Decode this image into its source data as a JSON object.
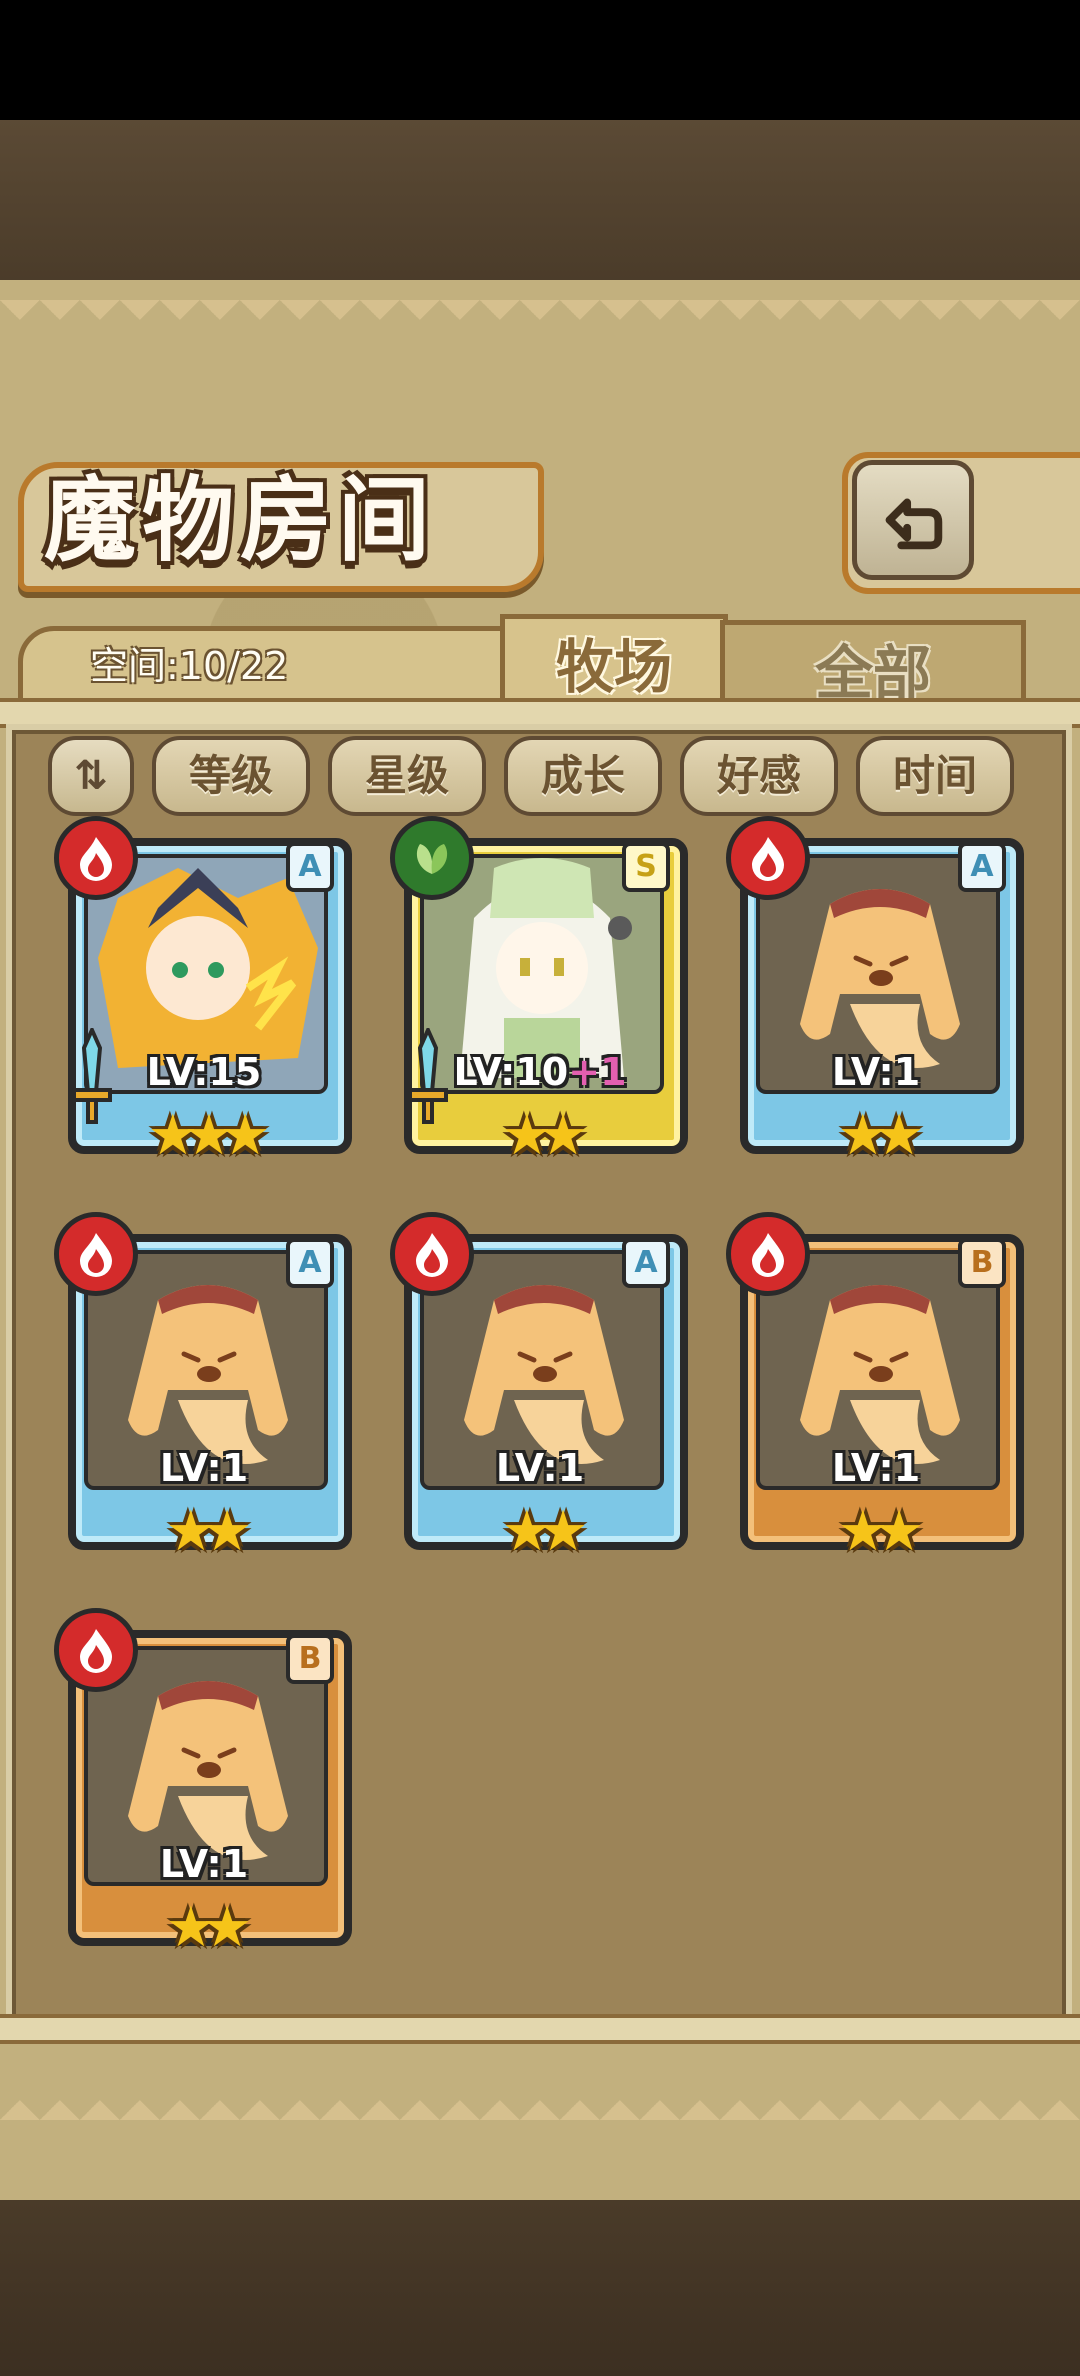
{
  "header": {
    "title": "魔物房间",
    "back_icon": "return-icon"
  },
  "storage": {
    "label": "空间:10/22"
  },
  "tabs": [
    {
      "label": "牧场",
      "active": true
    },
    {
      "label": "全部",
      "active": false
    }
  ],
  "sort": {
    "toggle_icon": "sort-toggle-icon",
    "buttons": [
      "等级",
      "星级",
      "成长",
      "好感",
      "时间"
    ]
  },
  "monsters": [
    {
      "rank": "A",
      "element": "fire",
      "level": "LV:15",
      "bonus": "",
      "stars": 3,
      "equipped": true,
      "portrait": "lightning-girl"
    },
    {
      "rank": "S",
      "element": "plant",
      "level": "LV:10",
      "bonus": "+1",
      "stars": 2,
      "equipped": true,
      "portrait": "leek-girl"
    },
    {
      "rank": "A",
      "element": "fire",
      "level": "LV:1",
      "bonus": "",
      "stars": 2,
      "equipped": false,
      "portrait": "pudding"
    },
    {
      "rank": "A",
      "element": "fire",
      "level": "LV:1",
      "bonus": "",
      "stars": 2,
      "equipped": false,
      "portrait": "pudding"
    },
    {
      "rank": "A",
      "element": "fire",
      "level": "LV:1",
      "bonus": "",
      "stars": 2,
      "equipped": false,
      "portrait": "pudding"
    },
    {
      "rank": "B",
      "element": "fire",
      "level": "LV:1",
      "bonus": "",
      "stars": 2,
      "equipped": false,
      "portrait": "pudding"
    },
    {
      "rank": "B",
      "element": "fire",
      "level": "LV:1",
      "bonus": "",
      "stars": 2,
      "equipped": false,
      "portrait": "pudding"
    }
  ],
  "colors": {
    "rank_a": "#7dc7e6",
    "rank_s": "#e8cd3d",
    "rank_b": "#d88f3d",
    "fire": "#d42b2b",
    "plant": "#2f7a2c",
    "star": "#f6c419"
  }
}
